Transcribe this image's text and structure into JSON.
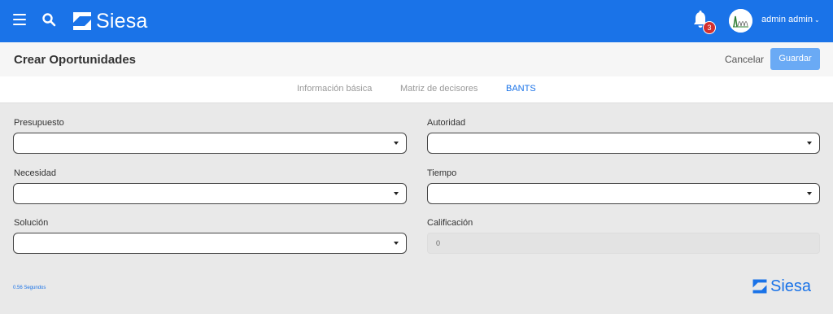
{
  "app": {
    "brand": "Siesa",
    "notifications_count": "3",
    "user_name": "admin admin",
    "colors": {
      "primary": "#1a73e8",
      "badge": "#d32f2f",
      "save": "#6aaaf5"
    }
  },
  "header": {
    "title": "Crear Oportunidades",
    "cancel_label": "Cancelar",
    "save_label": "Guardar"
  },
  "tabs": [
    {
      "label": "Información básica",
      "active": false
    },
    {
      "label": "Matriz de decisores",
      "active": false
    },
    {
      "label": "BANTS",
      "active": true
    }
  ],
  "form": {
    "presupuesto": {
      "label": "Presupuesto",
      "value": ""
    },
    "autoridad": {
      "label": "Autoridad",
      "value": ""
    },
    "necesidad": {
      "label": "Necesidad",
      "value": ""
    },
    "tiempo": {
      "label": "Tiempo",
      "value": ""
    },
    "solucion": {
      "label": "Solución",
      "value": ""
    },
    "calificacion": {
      "label": "Calificación",
      "value": "0"
    }
  },
  "footer": {
    "timing": "0.56 Segundos",
    "brand": "Siesa"
  },
  "icons": [
    "menu-icon",
    "search-icon",
    "bell-icon",
    "chevron-down-icon",
    "caret-down-icon"
  ]
}
